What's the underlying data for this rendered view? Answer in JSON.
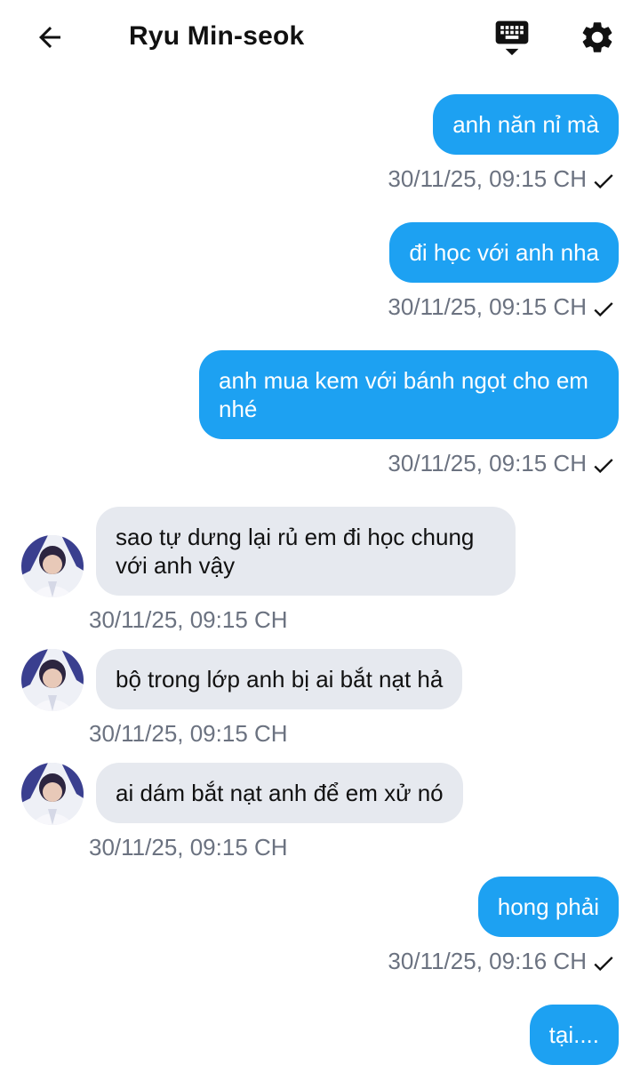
{
  "header": {
    "title": "Ryu Min-seok"
  },
  "messages": [
    {
      "dir": "out",
      "text": "anh năn nỉ mà",
      "time": "30/11/25, 09:15 CH"
    },
    {
      "dir": "out",
      "text": "đi học với anh nha",
      "time": "30/11/25, 09:15 CH"
    },
    {
      "dir": "out",
      "text": "anh mua kem với bánh ngọt cho em nhé",
      "time": "30/11/25, 09:15 CH"
    },
    {
      "dir": "in",
      "text": "sao tự dưng lại rủ em đi học chung với anh vậy",
      "time": "30/11/25, 09:15 CH"
    },
    {
      "dir": "in",
      "text": "bộ trong lớp anh bị ai bắt nạt hả",
      "time": "30/11/25, 09:15 CH"
    },
    {
      "dir": "in",
      "text": "ai dám bắt nạt anh để em xử nó",
      "time": "30/11/25, 09:15 CH"
    },
    {
      "dir": "out",
      "text": "hong phải",
      "time": "30/11/25, 09:16 CH"
    },
    {
      "dir": "out",
      "text": "tại....",
      "time": ""
    }
  ],
  "colors": {
    "outgoing_bubble": "#1da1f2",
    "incoming_bubble": "#e6e9ef",
    "timestamp": "#6b7280"
  },
  "icons": {
    "back": "arrow-left-icon",
    "keyboard": "keyboard-icon",
    "settings": "gear-icon",
    "read": "checkmark-icon"
  }
}
